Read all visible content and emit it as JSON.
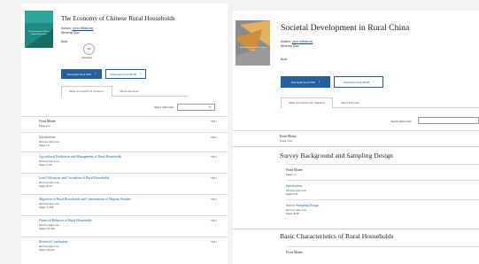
{
  "left": {
    "cover_text": "The Economy of Chinese Rural Households",
    "title": "The Economy of Chinese Rural Households",
    "authors_label": "Authors:",
    "affiliations_link": "(view affiliations)",
    "author_name": "Wenrong Qian",
    "book_label": "Book",
    "metric_value": "110",
    "metric_label": "Downloads",
    "download_pdf": "Download book PDF",
    "download_epub": "Download book EPUB",
    "tabs": [
      "Table of contents (6 chapters)",
      "About this book"
    ],
    "search_label": "Search within book",
    "chapters": [
      {
        "title": "Front Matter",
        "author": "Pages i-xvi",
        "pages": ""
      },
      {
        "title": "Introduction",
        "author": "Wenrong Qian et al.",
        "pages": "Pages 1-8"
      },
      {
        "title": "Agricultural Production and Management of Rural Households",
        "author": "Wenrong Qian et al.",
        "pages": "Pages 11-34"
      },
      {
        "title": "Land Utilization and Circulation of Rural Households",
        "author": "Wenrong Qian et al.",
        "pages": "Pages 35-76"
      },
      {
        "title": "Migration of Rural Households and Citizenization of Migrant Workers",
        "author": "Wenrong Qian et al.",
        "pages": "Pages 77-108"
      },
      {
        "title": "Financial Behavior of Rural Households",
        "author": "Wenrong Qian et al.",
        "pages": "Pages 127-180"
      },
      {
        "title": "Research Conclusions",
        "author": "Wenrong Qian et al.",
        "pages": "Pages 199-217"
      }
    ],
    "pdf_label": "PDF"
  },
  "right": {
    "cover_text": "Societal Development in Rural China",
    "title": "Societal Development in Rural China",
    "authors_label": "Authors:",
    "affiliations_link": "(view affiliations)",
    "author_name": "Wenrong Qian",
    "book_label": "Book",
    "download_pdf": "Download book PDF",
    "download_epub": "Download book EPUB",
    "tabs": [
      "Table of contents (11 chapters)",
      "About this book"
    ],
    "search_label": "Search within book",
    "front_matter": "Front Matter",
    "front_pages": "Pages i-xxvi",
    "section1": "Survey Background and Sampling Design",
    "sub_items": [
      {
        "title": "Front Matter",
        "author": "Pages 1-1",
        "pages": ""
      },
      {
        "title": "Introduction",
        "author": "Wenrong Qian et al.",
        "pages": "Pages 3-46"
      },
      {
        "title": "Survey Sampling Design",
        "author": "Wenrong Qian et al.",
        "pages": "Pages 49-65"
      }
    ],
    "section2": "Basic Characteristics of Rural Households",
    "section2_first": "Front Matter"
  },
  "colors": {
    "primary": "#24609e",
    "cover_left": "#2a8e86",
    "cover_right": "#d8a55a"
  },
  "icons": [
    "download-icon",
    "search-icon"
  ]
}
